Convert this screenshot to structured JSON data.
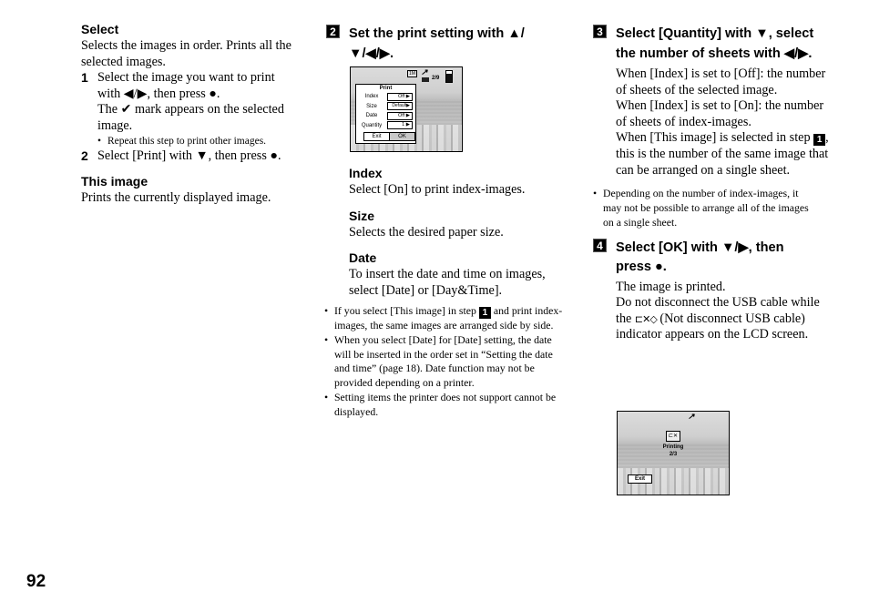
{
  "page_number": "92",
  "left_column": {
    "select": {
      "heading": "Select",
      "desc": "Selects the images in order. Prints all the selected images.",
      "steps": [
        {
          "num": "1",
          "text_a": "Select the image you want to print with ◀/▶, then press ●.",
          "text_b": "The ✔ mark appears on the selected image.",
          "note": "Repeat this step to print other images."
        },
        {
          "num": "2",
          "text_a": "Select [Print] with ▼, then press ●."
        }
      ]
    },
    "this_image": {
      "heading": "This image",
      "desc": "Prints the currently displayed image."
    }
  },
  "middle_column": {
    "step_number": "2",
    "step_heading": "Set the print setting with ▲/▼/◀/▶.",
    "screen": {
      "status_quality": "1M",
      "status_counter": "2/9",
      "menu_title": "Print",
      "rows": [
        {
          "label": "Index",
          "value": "Off ▶"
        },
        {
          "label": "Size",
          "value": "Default▶"
        },
        {
          "label": "Date",
          "value": "Off ▶"
        },
        {
          "label": "Quantity",
          "value": "1 ▶"
        }
      ],
      "exit_label": "Exit",
      "ok_label": "OK"
    },
    "items": [
      {
        "heading": "Index",
        "desc": "Select [On] to print index-images."
      },
      {
        "heading": "Size",
        "desc": "Selects the desired paper size."
      },
      {
        "heading": "Date",
        "desc": "To insert the date and time on images, select [Date] or [Day&Time]."
      }
    ],
    "notes": {
      "note1_a": "If you select [This image] in step",
      "note1_step": "1",
      "note1_b": "and print index-images, the same images are arranged side by side.",
      "note2": "When you select [Date] for [Date] setting, the date will be inserted in the order set in “Setting the date and time” (page 18). Date function may not be provided depending on a printer.",
      "note3": "Setting items the printer does not support cannot be displayed."
    }
  },
  "right_column": {
    "step3": {
      "number": "3",
      "heading": "Select [Quantity] with ▼, select the number of sheets with ◀/▶.",
      "para1": "When [Index] is set to [Off]: the number of sheets of the selected image.",
      "para2": "When [Index] is set to [On]: the number of sheets of index-images.",
      "para3_a": "When [This image] is selected in step",
      "para3_step": "1",
      "para3_b": ", this is the number of the same image that can be arranged on a single sheet.",
      "note": "Depending on the number of index-images, it may not be possible to arrange all of the images on a single sheet."
    },
    "step4": {
      "number": "4",
      "heading": "Select [OK] with ▼/▶, then press ●.",
      "line1": "The image is printed.",
      "line2_a": "Do not disconnect the USB cable while the",
      "line2_b": "(Not disconnect USB cable) indicator appears on the LCD screen.",
      "icon": "usb-disconnect-warning-icon"
    },
    "screen": {
      "status_label": "Printing",
      "status_count": "2/3",
      "exit_label": "Exit"
    }
  }
}
